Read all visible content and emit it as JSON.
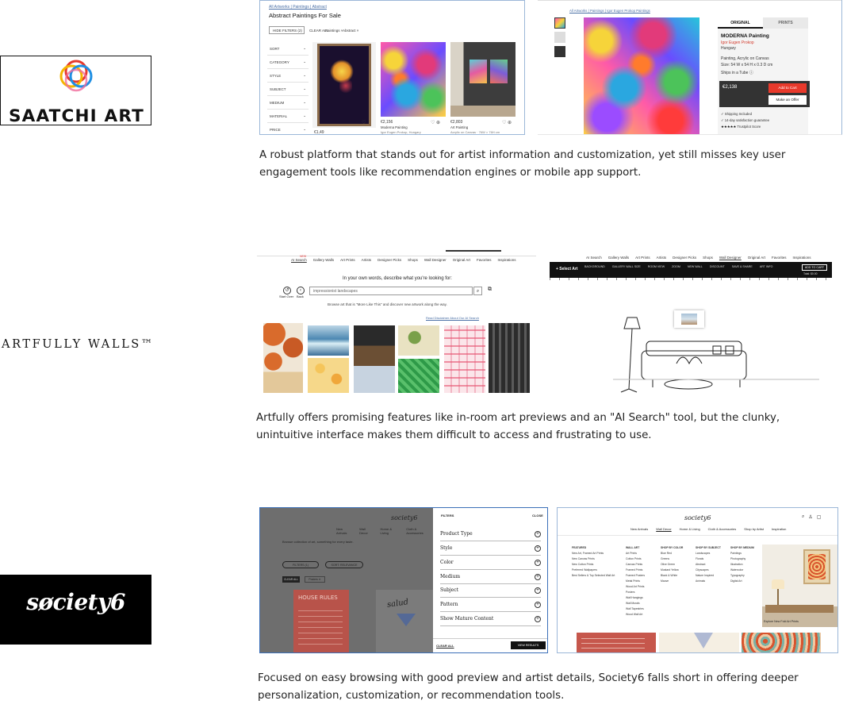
{
  "saatchi": {
    "logo_text": "SAATCHI ART",
    "listing": {
      "breadcrumb": "All Artworks | Paintings | Abstract",
      "title": "Abstract Paintings For Sale",
      "filters_btn": "HIDE FILTERS (2)",
      "clear_all": "CLEAR ALL",
      "chip1": "Paintings ×",
      "chip2": "Abstract ×",
      "sidebar": [
        "SORT",
        "CATEGORY",
        "STYLE",
        "SUBJECT",
        "MEDIUM",
        "MATERIAL",
        "PRICE"
      ],
      "price1": "€2,156",
      "name1": "Moderna Painting",
      "artist1": "Igor Eugen Prokop, Hungary",
      "price2": "€2,803",
      "name2": "Art Painting",
      "artist2": "Acrylic on Canvas · 76W × 76H cm",
      "price0": "€1,49"
    },
    "detail": {
      "breadcrumb": "All Artworks | Paintings | Igor Eugen Prokop Paintings",
      "tab_original": "ORIGINAL",
      "tab_prints": "PRINTS",
      "title": "MODERNA Painting",
      "artist": "Igor Eugen Prokop",
      "country": "Hungary",
      "medium": "Painting, Acrylic on Canvas",
      "size": "Size: 54 W x 54 H x 0.3 D cm",
      "ships": "Ships in a Tube",
      "price": "€2,138",
      "add_to_cart": "Add to Cart",
      "make_offer": "Make an Offer",
      "shipping": "Shipping Included",
      "guarantee": "14-day satisfaction guarantee",
      "trustpilot": "Trustpilot Score"
    },
    "caption": "A robust platform that stands out for artist information and customization, yet still misses key user engagement tools like recommendation engines or mobile app support."
  },
  "artfully": {
    "logo_text": "ARTFULLY WALLS™",
    "search": {
      "nav": [
        "AI Search",
        "Gallery Walls",
        "Art Prints",
        "Artists",
        "Designer Picks",
        "Shops",
        "Wall Designer",
        "Original Art",
        "Favorites",
        "Inspirations"
      ],
      "new_badge": "NEW",
      "heading": "In your own words, describe what you're looking for:",
      "input_value": "impressionist landscapes",
      "start_over": "Start Over",
      "back": "Back",
      "sub": "Browse art that is \"More Like This\" and discover new artwork along the way.",
      "read_more": "Read Disclaimer About Our AI Search"
    },
    "designer": {
      "select_art": "+ Select Art",
      "tools": [
        "BACKGROUND",
        "GALLERY WALL SIZE",
        "ROOM VIEW",
        "ZOOM",
        "NEW WALL",
        "DISCOUNT",
        "SAVE & SHARE",
        "ART INFO"
      ],
      "add_to_cart": "ADD TO CART",
      "total": "Total: $0.00"
    },
    "caption": "Artfully offers promising features like in-room art previews and an \"AI Search\" tool, but the clunky, unintuitive interface makes them difficult to access and frustrating to use."
  },
  "society6": {
    "logo_text": "søciety6",
    "filters": {
      "brand": "society6",
      "header": "FILTERS",
      "close": "CLOSE",
      "rows": [
        "Product Type",
        "Style",
        "Color",
        "Medium",
        "Subject",
        "Pattern",
        "Show Mature Content"
      ],
      "clear_all": "CLEAR ALL",
      "view_results": "VIEW RESULTS",
      "nav": [
        "New Arrivals",
        "Wall Decor",
        "Home & Living",
        "Cloth & Accessories"
      ],
      "bg_sub": "Browse collection of art, something for every taste.",
      "chip_filters": "FILTERS (1)",
      "chip_sort": "SORT: RELEVANCE",
      "clear_chip": "CLEAR ALL",
      "bg_card1": "HOUSE RULES",
      "bg_card2": "salud"
    },
    "menu": {
      "brand": "society6",
      "nav": [
        "New Arrivals",
        "Wall Decor",
        "Home & Living",
        "Cloth & Accessories",
        "Shop by Artist",
        "Inspiration"
      ],
      "col_featured": "FEATURED",
      "featured": [
        "New Art, Framed Art Prints",
        "New Canvas Prints",
        "New Cotton Prints",
        "Preferred Wallpapers",
        "Best Sellers & Top Selected Wall Art"
      ],
      "col_wall": "WALL ART",
      "wall": [
        "Art Prints",
        "Cotton Prints",
        "Canvas Prints",
        "Framed Prints",
        "Framed Posters",
        "Metal Prints",
        "Wood Art Prints",
        "Posters",
        "Wall Hangings",
        "Wall Murals",
        "Wall Tapestries",
        "Wood Wall Art"
      ],
      "col_color": "SHOP BY COLOR",
      "color": [
        "Blue Red",
        "Greens",
        "Olive Green",
        "Mustard Yellow",
        "Black & White",
        "Mauve"
      ],
      "col_subject": "SHOP BY SUBJECT",
      "subject": [
        "Landscapes",
        "Florals",
        "Abstract",
        "Cityscapes",
        "Nature Inspired",
        "Animals"
      ],
      "col_medium": "SHOP BY MEDIUM",
      "medium": [
        "Paintings",
        "Photography",
        "Illustration",
        "Watercolor",
        "Typography",
        "Digital Art"
      ],
      "explore": "Explore New Fold Art Prints"
    },
    "caption": "Focused on easy browsing with good preview and artist details, Society6 falls short in offering deeper personalization, customization, or recommendation tools."
  }
}
